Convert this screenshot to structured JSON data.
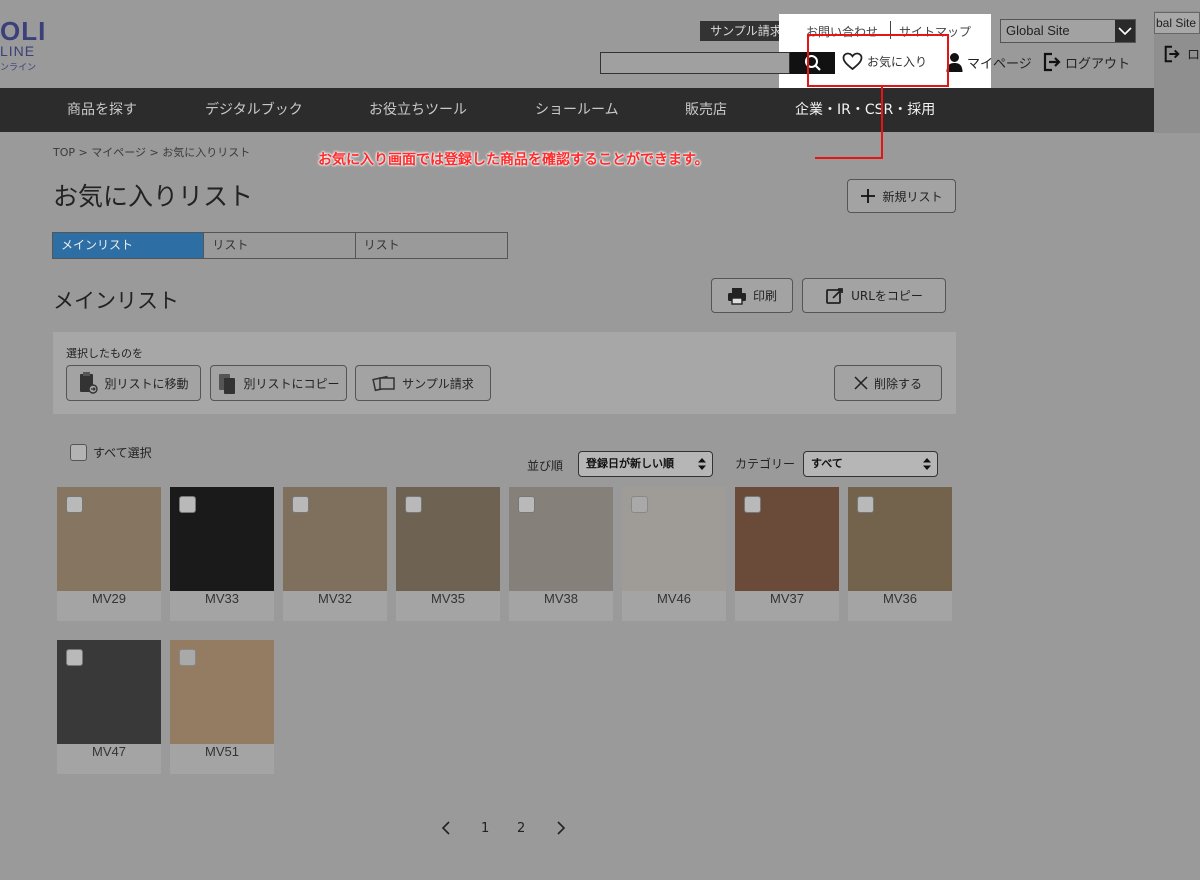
{
  "logo": {
    "line1": "OLI",
    "line2": "LINE",
    "line3": "ンライン"
  },
  "header": {
    "sample_request": "サンプル請求",
    "contact": "お問い合わせ",
    "sitemap": "サイトマップ",
    "global_site": "Global Site",
    "favorites": "お気に入り",
    "mypage": "マイページ",
    "logout": "ログアウト",
    "right_global": "bal Site",
    "right_logout": "ロ"
  },
  "nav": [
    "商品を探す",
    "デジタルブック",
    "お役立ちツール",
    "ショールーム",
    "販売店",
    "企業・IR・CSR・採用"
  ],
  "callout": "お気に入り画面では登録した商品を確認することができます。",
  "breadcrumb": "TOP > マイページ > お気に入りリスト",
  "page_title": "お気に入りリスト",
  "new_list_button": "新規リスト",
  "tabs": [
    "メインリスト",
    "リスト",
    "リスト"
  ],
  "list_title": "メインリスト",
  "print_button": "印刷",
  "url_copy_button": "URLをコピー",
  "selection": {
    "label": "選択したものを",
    "move": "別リストに移動",
    "copy": "別リストにコピー",
    "sample": "サンプル請求",
    "delete": "削除する"
  },
  "select_all": "すべて選択",
  "sort": {
    "label": "並び順",
    "value": "登録日が新しい順"
  },
  "category": {
    "label": "カテゴリー",
    "value": "すべて"
  },
  "products": [
    {
      "code": "MV29",
      "color": "#867560"
    },
    {
      "code": "MV33",
      "color": "#1a1a1a"
    },
    {
      "code": "MV32",
      "color": "#7f705e"
    },
    {
      "code": "MV35",
      "color": "#6e6252"
    },
    {
      "code": "MV38",
      "color": "#858079"
    },
    {
      "code": "MV46",
      "color": "#9f9c97"
    },
    {
      "code": "MV37",
      "color": "#6a4a39"
    },
    {
      "code": "MV36",
      "color": "#73624c"
    },
    {
      "code": "MV47",
      "color": "#393939"
    },
    {
      "code": "MV51",
      "color": "#937c61"
    }
  ],
  "pagination": {
    "prev": "‹",
    "pages": [
      "1",
      "2"
    ],
    "next": "›"
  },
  "colors": {
    "accent_tab": "#2d6ea5",
    "navbar": "#2c2c2c",
    "callout_red": "#e61515"
  }
}
